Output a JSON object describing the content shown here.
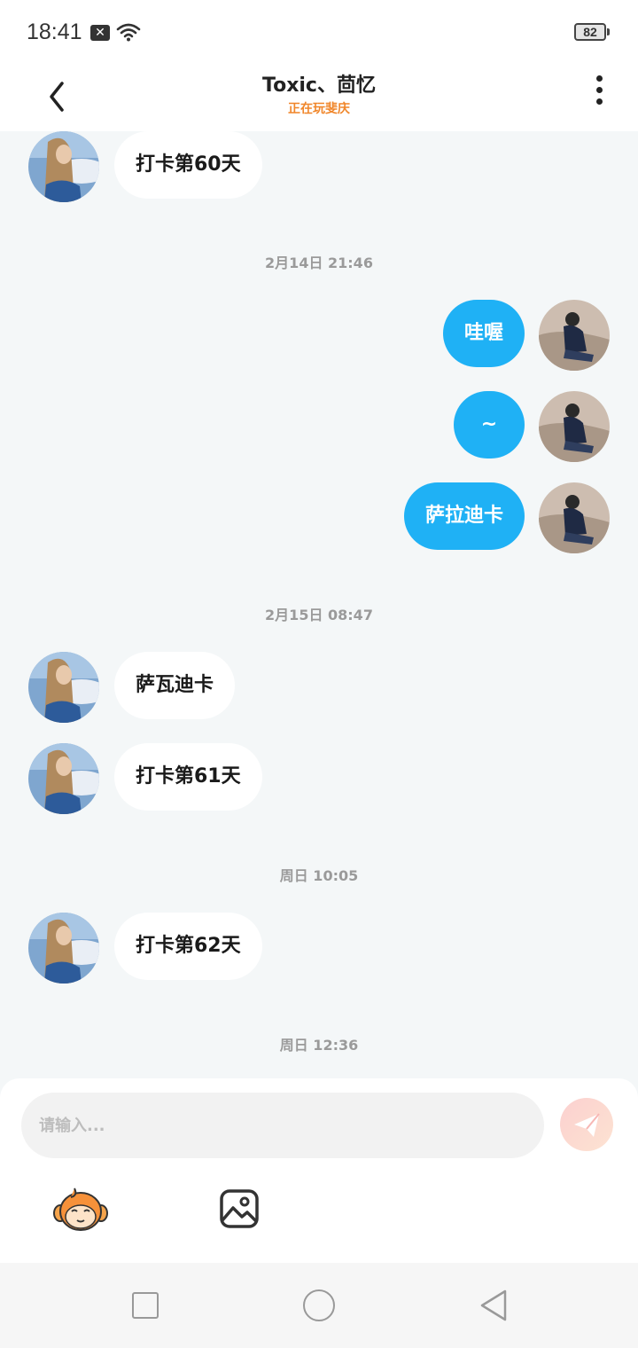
{
  "status_bar": {
    "time": "18:41",
    "battery": "82"
  },
  "header": {
    "title": "Toxic、茴忆",
    "subtitle": "正在玩斐庆"
  },
  "messages": [
    {
      "kind": "in",
      "text": "打卡第60天"
    },
    {
      "kind": "timestamp",
      "text": "2月14日  21:46"
    },
    {
      "kind": "out",
      "text": "哇喔"
    },
    {
      "kind": "out",
      "text": "~"
    },
    {
      "kind": "out",
      "text": "萨拉迪卡"
    },
    {
      "kind": "timestamp",
      "text": "2月15日  08:47"
    },
    {
      "kind": "in",
      "text": "萨瓦迪卡"
    },
    {
      "kind": "in",
      "text": "打卡第61天"
    },
    {
      "kind": "timestamp",
      "text": "周日  10:05"
    },
    {
      "kind": "in",
      "text": "打卡第62天"
    },
    {
      "kind": "timestamp",
      "text": "周日  12:36"
    }
  ],
  "input": {
    "placeholder": "请输入..."
  },
  "icons": {
    "back": "chevron-left-icon",
    "more": "more-vertical-icon",
    "send": "paper-plane-icon",
    "emoji": "monkey-emoji-icon",
    "image": "image-icon"
  },
  "colors": {
    "outgoing_bubble": "#1fb1f5",
    "incoming_bubble": "#ffffff",
    "subtitle": "#f0862a",
    "background": "#f4f7f8"
  }
}
